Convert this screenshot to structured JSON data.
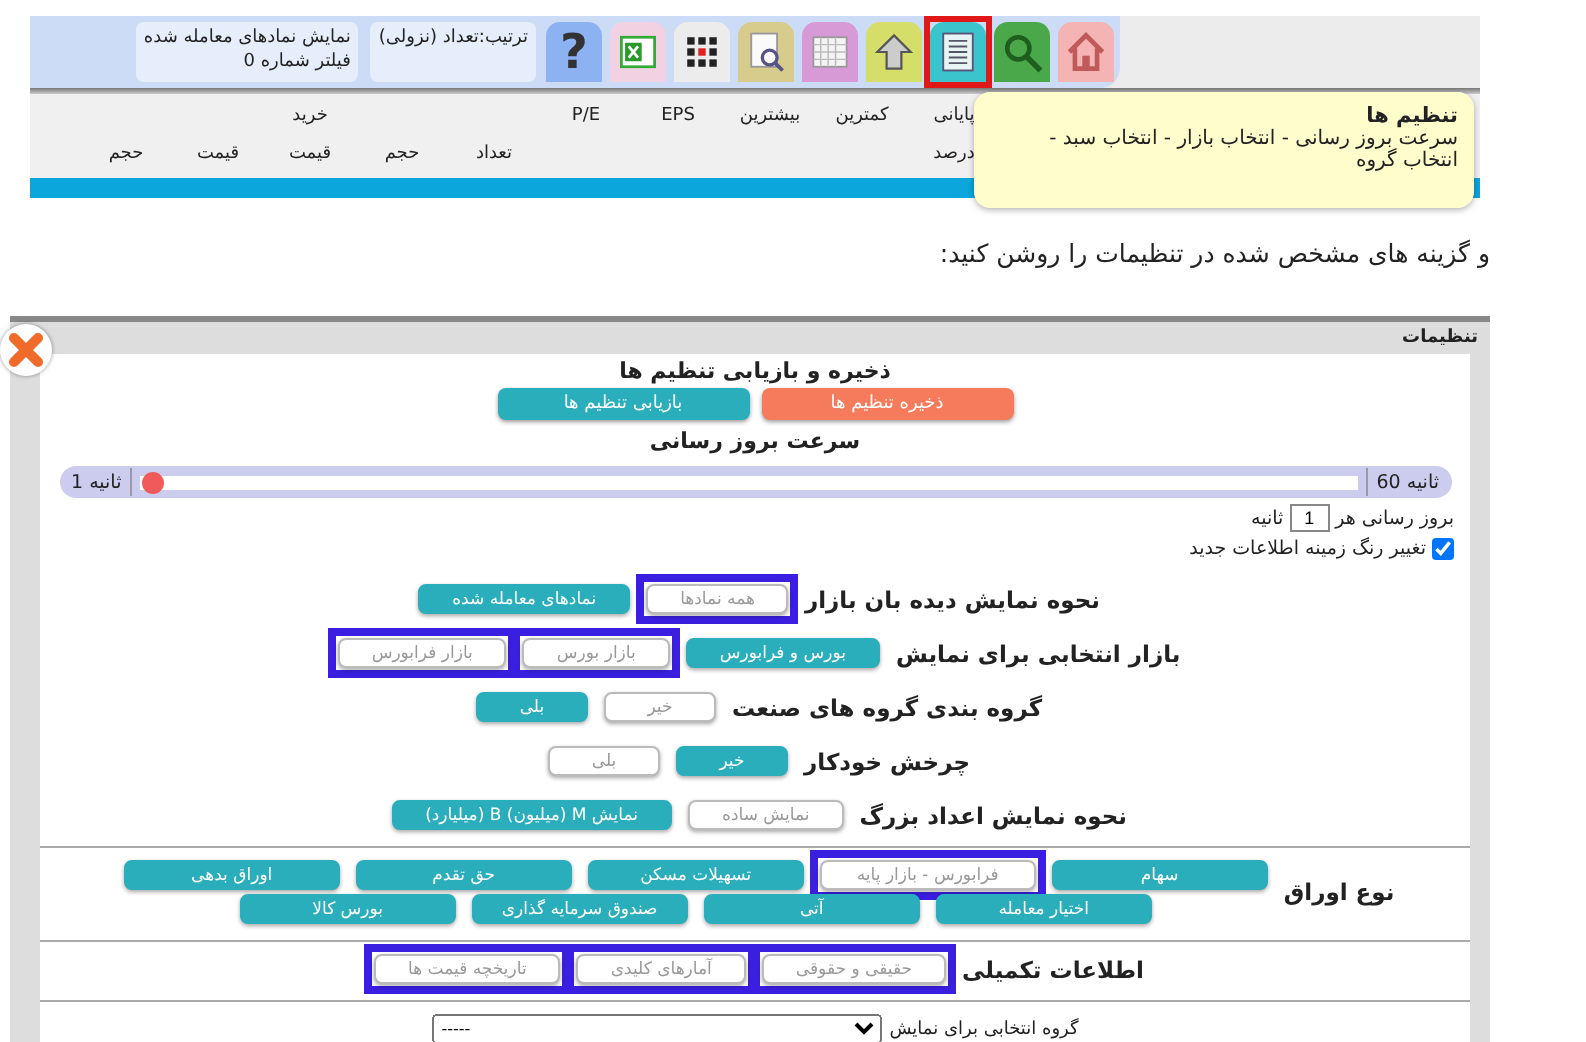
{
  "toolbar": {
    "tools": [
      {
        "kind": "home",
        "highlighted": false
      },
      {
        "kind": "search",
        "highlighted": false
      },
      {
        "kind": "settings-list",
        "highlighted": true
      },
      {
        "kind": "up",
        "highlighted": false
      },
      {
        "kind": "calendar",
        "highlighted": false
      },
      {
        "kind": "doc-search",
        "highlighted": false
      },
      {
        "kind": "grid",
        "highlighted": false
      },
      {
        "kind": "excel",
        "highlighted": false
      },
      {
        "kind": "help",
        "highlighted": false,
        "glyph": "?"
      }
    ],
    "info_boxes": [
      {
        "lines": [
          "ترتیب:تعداد (نزولی)"
        ]
      },
      {
        "lines": [
          "نمایش نمادهای معامله شده",
          "فیلتر شماره 0"
        ]
      }
    ]
  },
  "table_header": {
    "columns": [
      {
        "top": "پایانی",
        "bottom": "درصد"
      },
      {
        "top": "کمترین"
      },
      {
        "top": "بیشترین"
      },
      {
        "top": "EPS"
      },
      {
        "top": "P/E"
      },
      {
        "bottom": "تعداد"
      },
      {
        "bottom": "حجم"
      },
      {
        "top": "خرید",
        "bottom": "قیمت"
      },
      {
        "bottom": "قیمت"
      },
      {
        "bottom": "حجم"
      }
    ]
  },
  "tooltip": {
    "title": "تنظیم ها",
    "text": "سرعت بروز رسانی - انتخاب بازار - انتخاب سبد - انتخاب گروه"
  },
  "caption": "و گزینه های مشخص شده در تنظیمات را روشن کنید:",
  "settings": {
    "title": "تنظیمات",
    "save_heading": "ذخیره و بازیابی تنظیم ها",
    "actions": [
      {
        "kind": "save",
        "label": "ذخیره تنظیم ها"
      },
      {
        "kind": "restore",
        "label": "بازیابی تنظیم ها"
      }
    ],
    "speed_heading": "سرعت بروز رسانی",
    "speed_slider": {
      "max_label": "ثانیه 60",
      "min_label": "ثانیه 1",
      "level": 0.01
    },
    "interval": {
      "prefix": "بروز رسانی هر",
      "value": "1",
      "suffix": "ثانیه"
    },
    "highlight_new": {
      "label": "تغییر رنگ زمینه اطلاعات جدید",
      "checked": true
    },
    "groups": [
      {
        "label": "نحوه نمایش دیده بان بازار",
        "divider_before": false,
        "options": [
          {
            "label": "همه نمادها",
            "selected": false,
            "highlighted": true
          },
          {
            "label": "نمادهای معامله شده",
            "selected": true,
            "highlighted": false
          }
        ]
      },
      {
        "label": "بازار انتخابی برای نمایش",
        "divider_before": false,
        "options": [
          {
            "label": "بورس و فرابورس",
            "selected": true,
            "highlighted": false
          },
          {
            "label": "بازار بورس",
            "selected": false,
            "highlighted": true
          },
          {
            "label": "بازار فرابورس",
            "selected": false,
            "highlighted": true
          }
        ]
      },
      {
        "label": "گروه بندی گروه های صنعت",
        "divider_before": false,
        "options": [
          {
            "label": "خیر",
            "selected": false,
            "highlighted": false
          },
          {
            "label": "بلی",
            "selected": true,
            "highlighted": false
          }
        ]
      },
      {
        "label": "چرخش خودکار",
        "divider_before": false,
        "options": [
          {
            "label": "خیر",
            "selected": true,
            "highlighted": false
          },
          {
            "label": "بلی",
            "selected": false,
            "highlighted": false
          }
        ]
      },
      {
        "label": "نحوه نمایش اعداد بزرگ",
        "divider_before": false,
        "options": [
          {
            "label": "نمایش ساده",
            "selected": false,
            "highlighted": false
          },
          {
            "label": "نمایش M (میلیون) B (میلیارد)",
            "selected": true,
            "highlighted": false
          }
        ]
      },
      {
        "label": "نوع اوراق",
        "divider_before": true,
        "options": [
          {
            "label": "سهام",
            "selected": true,
            "highlighted": false
          },
          {
            "label": "فرابورس - بازار پایه",
            "selected": false,
            "highlighted": true
          },
          {
            "label": "تسهیلات مسکن",
            "selected": true,
            "highlighted": false
          },
          {
            "label": "حق تقدم",
            "selected": true,
            "highlighted": false
          },
          {
            "label": "اوراق بدهی",
            "selected": true,
            "highlighted": false
          },
          {
            "label": "اختیار معامله",
            "selected": true,
            "highlighted": false
          },
          {
            "label": "آتی",
            "selected": true,
            "highlighted": false
          },
          {
            "label": "صندوق سرمایه گذاری",
            "selected": true,
            "highlighted": false
          },
          {
            "label": "بورس کالا",
            "selected": true,
            "highlighted": false
          }
        ]
      },
      {
        "label": "اطلاعات تکمیلی",
        "divider_before": true,
        "options": [
          {
            "label": "حقیقی و حقوقی",
            "selected": false,
            "highlighted": true
          },
          {
            "label": "آمارهای کلیدی",
            "selected": false,
            "highlighted": true
          },
          {
            "label": "تاریخچه قیمت ها",
            "selected": false,
            "highlighted": true
          }
        ]
      }
    ],
    "group_select": {
      "label": "گروه انتخابی برای نمایش",
      "value": "-----"
    }
  }
}
